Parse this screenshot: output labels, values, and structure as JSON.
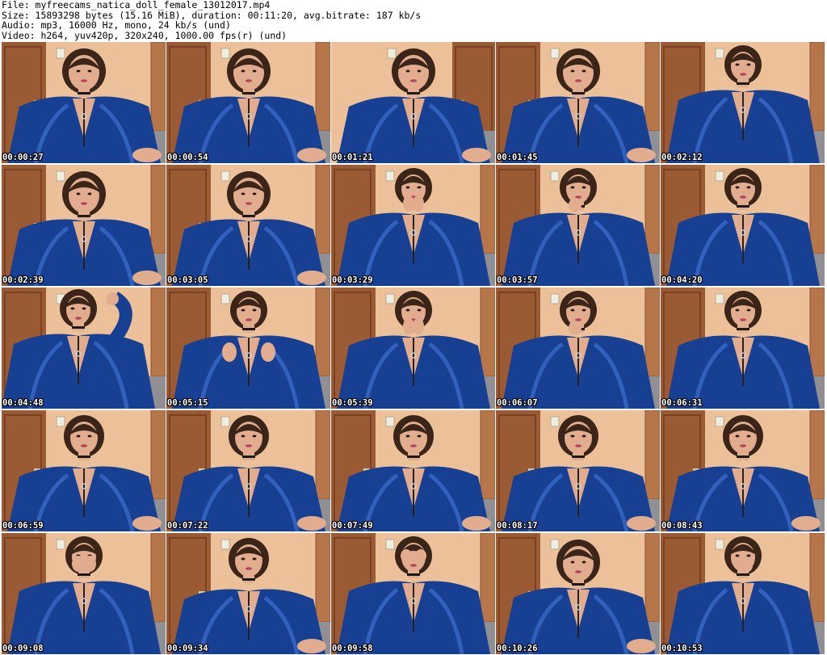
{
  "header": {
    "file_line": "File: myfreecams_natica_doll_female_13012017.mp4",
    "size_line": "Size: 15893298 bytes (15.16 MiB), duration: 00:11:20, avg.bitrate: 187 kb/s",
    "audio_line": "Audio: mp3, 16000 Hz, mono, 24 kb/s (und)",
    "video_line": "Video: h264, yuv420p, 320x240, 1000.00 fps(r) (und)"
  },
  "thumbnails": [
    {
      "time": "00:00:27",
      "pose": "lean",
      "scene": "door-left"
    },
    {
      "time": "00:00:54",
      "pose": "lean",
      "scene": "door-left"
    },
    {
      "time": "00:01:21",
      "pose": "lean",
      "scene": "door-right"
    },
    {
      "time": "00:01:45",
      "pose": "lean",
      "scene": "door-left"
    },
    {
      "time": "00:02:12",
      "pose": "upright",
      "scene": "door-left"
    },
    {
      "time": "00:02:39",
      "pose": "lean",
      "scene": "door-left"
    },
    {
      "time": "00:03:05",
      "pose": "lean",
      "scene": "door-left"
    },
    {
      "time": "00:03:29",
      "pose": "hands-face",
      "scene": "door-left"
    },
    {
      "time": "00:03:57",
      "pose": "hand-chin",
      "scene": "door-left"
    },
    {
      "time": "00:04:20",
      "pose": "upright",
      "scene": "door-left"
    },
    {
      "time": "00:04:48",
      "pose": "arm-up",
      "scene": "door-left"
    },
    {
      "time": "00:05:15",
      "pose": "hands-chest",
      "scene": "door-left"
    },
    {
      "time": "00:05:39",
      "pose": "hands-chin",
      "scene": "door-left"
    },
    {
      "time": "00:06:07",
      "pose": "hand-chin",
      "scene": "door-left"
    },
    {
      "time": "00:06:31",
      "pose": "upright",
      "scene": "door-left"
    },
    {
      "time": "00:06:59",
      "pose": "lean-down",
      "scene": "door-left"
    },
    {
      "time": "00:07:22",
      "pose": "lean-down",
      "scene": "door-left"
    },
    {
      "time": "00:07:49",
      "pose": "lean-down",
      "scene": "door-left"
    },
    {
      "time": "00:08:17",
      "pose": "lean-down",
      "scene": "door-left"
    },
    {
      "time": "00:08:43",
      "pose": "lean-down",
      "scene": "door-left"
    },
    {
      "time": "00:09:08",
      "pose": "hands-mouth",
      "scene": "door-left"
    },
    {
      "time": "00:09:34",
      "pose": "lean-down",
      "scene": "door-left"
    },
    {
      "time": "00:09:58",
      "pose": "hands-eyes",
      "scene": "door-left"
    },
    {
      "time": "00:10:26",
      "pose": "lean",
      "scene": "door-left"
    },
    {
      "time": "00:10:53",
      "pose": "hand-mouth",
      "scene": "door-left"
    }
  ],
  "colors": {
    "wall": "#e9b98f",
    "door": "#9a5a34",
    "robe": "#173f92",
    "robe_highlight": "#3f6fd0",
    "skin": "#e2ad8f",
    "hair": "#3a2518",
    "timestamp_text": "#ffffff",
    "timestamp_outline": "#000000"
  }
}
